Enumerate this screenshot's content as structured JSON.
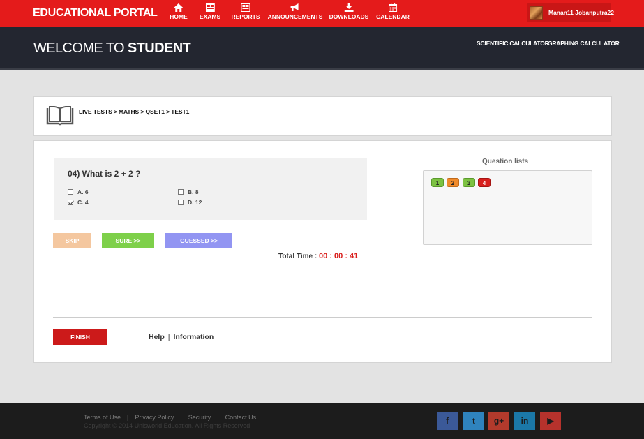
{
  "app": {
    "brand": "EDUCATIONAL PORTAL"
  },
  "nav": [
    {
      "label": "HOME",
      "icon": "home-icon"
    },
    {
      "label": "EXAMS",
      "icon": "exams-icon"
    },
    {
      "label": "REPORTS",
      "icon": "reports-icon"
    },
    {
      "label": "ANNOUNCEMENTS",
      "icon": "megaphone-icon"
    },
    {
      "label": "DOWNLOADS",
      "icon": "download-icon"
    },
    {
      "label": "CALENDAR",
      "icon": "calendar-icon"
    }
  ],
  "user": {
    "name": "Manan11 Jobanputra22"
  },
  "header": {
    "welcome_prefix": "WELCOME TO",
    "welcome_name": "STUDENT",
    "links": [
      "SCIENTIFIC CALCULATOR",
      "GRAPHING CALCULATOR"
    ]
  },
  "breadcrumb": {
    "text": "LIVE TESTS > MATHS > QSET1 > TEST1"
  },
  "question": {
    "title": "04) What is 2 + 2 ?",
    "options": [
      {
        "label": "A. 6",
        "checked": false
      },
      {
        "label": "B. 8",
        "checked": false
      },
      {
        "label": "C. 4",
        "checked": true
      },
      {
        "label": "D. 12",
        "checked": false
      }
    ]
  },
  "actions": {
    "skip": "SKIP",
    "sure": "SURE >>",
    "guessed": "GUESSED >>",
    "finish": "FINISH"
  },
  "timer": {
    "label": "Total Time :",
    "hh": "00",
    "mm": "00",
    "ss": "41"
  },
  "question_list": {
    "title": "Question lists",
    "items": [
      {
        "number": "1",
        "color": "#7cc242"
      },
      {
        "number": "2",
        "color": "#f08a2a"
      },
      {
        "number": "3",
        "color": "#7cc242"
      },
      {
        "number": "4",
        "color": "#d8201e"
      }
    ]
  },
  "help": {
    "help": "Help",
    "info": "Information"
  },
  "footer": {
    "links": [
      "Terms of Use",
      "Privacy Policy",
      "Security",
      "Contact Us"
    ],
    "copyright": "Copyright © 2014 Unisworld Education. All Rights Reserved",
    "social": [
      {
        "name": "facebook-icon",
        "glyph": "f",
        "color": "#3b5998"
      },
      {
        "name": "twitter-icon",
        "glyph": "t",
        "color": "#2f83bd"
      },
      {
        "name": "google-plus-icon",
        "glyph": "g+",
        "color": "#b23a2c"
      },
      {
        "name": "linkedin-icon",
        "glyph": "in",
        "color": "#1b78a8"
      },
      {
        "name": "youtube-icon",
        "glyph": "▶",
        "color": "#b6322c"
      }
    ]
  },
  "colors": {
    "brand_red": "#e41b1b",
    "header_dark": "#232630",
    "timer_red": "#d9201e"
  }
}
